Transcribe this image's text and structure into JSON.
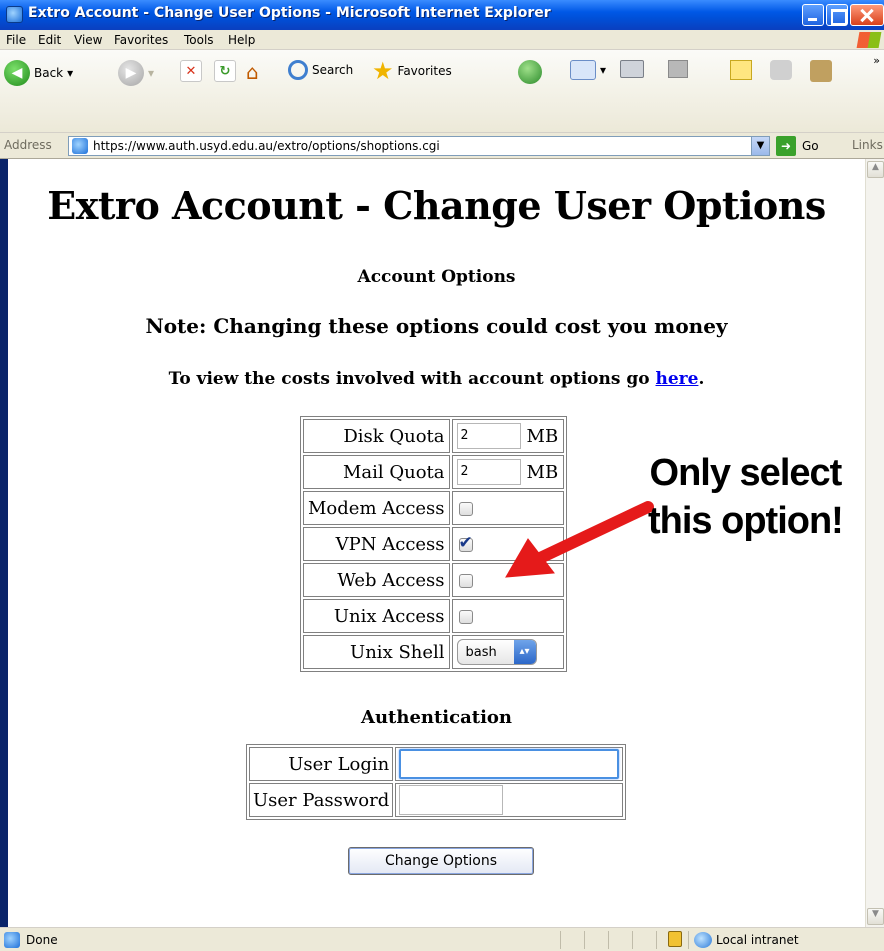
{
  "window": {
    "title": "Extro Account - Change User Options - Microsoft Internet Explorer"
  },
  "menubar": {
    "items": [
      "File",
      "Edit",
      "View",
      "Favorites",
      "Tools",
      "Help"
    ]
  },
  "toolbar": {
    "back_label": "Back",
    "search_label": "Search",
    "favorites_label": "Favorites"
  },
  "address": {
    "label": "Address",
    "url": "https://www.auth.usyd.edu.au/extro/options/shoptions.cgi",
    "go_label": "Go",
    "links_label": "Links"
  },
  "page": {
    "title": "Extro Account - Change User Options",
    "account_options_heading": "Account Options",
    "note": "Note: Changing these options could cost you money",
    "cost_text": "To view the costs involved with account options go ",
    "cost_link": "here",
    "cost_suffix": "."
  },
  "options": {
    "disk_quota": {
      "label": "Disk Quota",
      "value": "2",
      "unit": "MB"
    },
    "mail_quota": {
      "label": "Mail Quota",
      "value": "2",
      "unit": "MB"
    },
    "modem_access": {
      "label": "Modem Access",
      "checked": false
    },
    "vpn_access": {
      "label": "VPN Access",
      "checked": true
    },
    "web_access": {
      "label": "Web Access",
      "checked": false
    },
    "unix_access": {
      "label": "Unix Access",
      "checked": false
    },
    "unix_shell": {
      "label": "Unix Shell",
      "value": "bash"
    }
  },
  "authentication": {
    "heading": "Authentication",
    "user_login_label": "User Login",
    "user_password_label": "User Password",
    "submit_label": "Change Options"
  },
  "annotation": {
    "line1": "Only select",
    "line2": "this option!",
    "arrow_color": "#e51a1a"
  },
  "statusbar": {
    "status": "Done",
    "zone": "Local intranet"
  }
}
